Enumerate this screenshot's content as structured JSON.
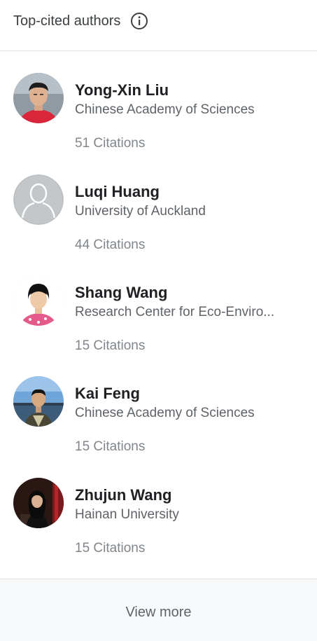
{
  "header": {
    "title": "Top-cited authors",
    "info_icon": "info-circle-icon"
  },
  "authors": [
    {
      "name": "Yong-Xin Liu",
      "affiliation": "Chinese Academy of Sciences",
      "citations": "51 Citations"
    },
    {
      "name": "Luqi Huang",
      "affiliation": "University of Auckland",
      "citations": "44 Citations"
    },
    {
      "name": "Shang Wang",
      "affiliation": "Research Center for Eco-Enviro...",
      "citations": "15 Citations"
    },
    {
      "name": "Kai Feng",
      "affiliation": "Chinese Academy of Sciences",
      "citations": "15 Citations"
    },
    {
      "name": "Zhujun Wang",
      "affiliation": "Hainan University",
      "citations": "15 Citations"
    }
  ],
  "footer": {
    "view_more": "View more"
  },
  "colors": {
    "name": "#202124",
    "affiliation": "#5f6368",
    "citations": "#80868b",
    "divider": "#e0e0e0",
    "footer_bg": "#f8f9fa"
  }
}
